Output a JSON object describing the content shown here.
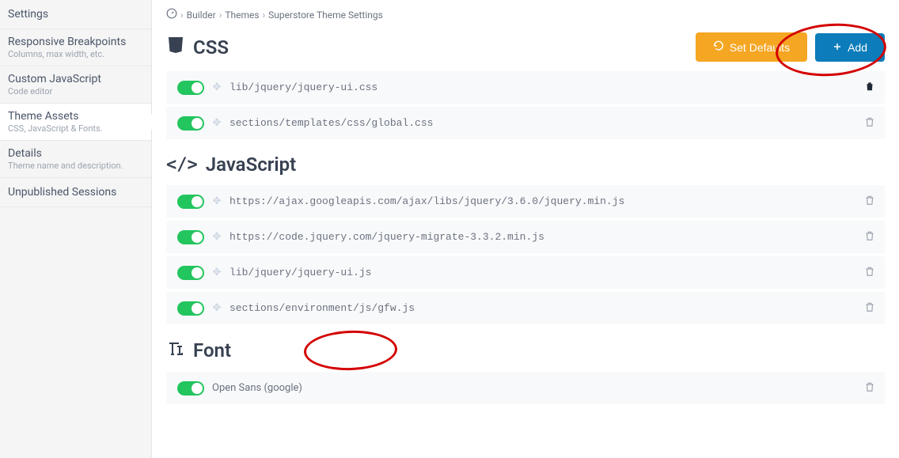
{
  "breadcrumb": {
    "items": [
      "Builder",
      "Themes",
      "Superstore Theme Settings"
    ]
  },
  "sidebar": {
    "items": [
      {
        "title": "Settings",
        "sub": ""
      },
      {
        "title": "Responsive Breakpoints",
        "sub": "Columns, max width, etc."
      },
      {
        "title": "Custom JavaScript",
        "sub": "Code editor"
      },
      {
        "title": "Theme Assets",
        "sub": "CSS, JavaScript & Fonts."
      },
      {
        "title": "Details",
        "sub": "Theme name and description."
      },
      {
        "title": "Unpublished Sessions",
        "sub": ""
      }
    ]
  },
  "buttons": {
    "set_defaults": "Set Defaults",
    "add": "Add"
  },
  "sections": {
    "css": {
      "title": "CSS"
    },
    "js": {
      "title": "JavaScript"
    },
    "font": {
      "title": "Font"
    }
  },
  "css_assets": [
    {
      "path": "lib/jquery/jquery-ui.css"
    },
    {
      "path": "sections/templates/css/global.css"
    }
  ],
  "js_assets": [
    {
      "path": "https://ajax.googleapis.com/ajax/libs/jquery/3.6.0/jquery.min.js"
    },
    {
      "path": "https://code.jquery.com/jquery-migrate-3.3.2.min.js"
    },
    {
      "path": "lib/jquery/jquery-ui.js"
    },
    {
      "path": "sections/environment/js/gfw.js"
    }
  ],
  "font_assets": [
    {
      "name": "Open Sans (google)"
    }
  ]
}
